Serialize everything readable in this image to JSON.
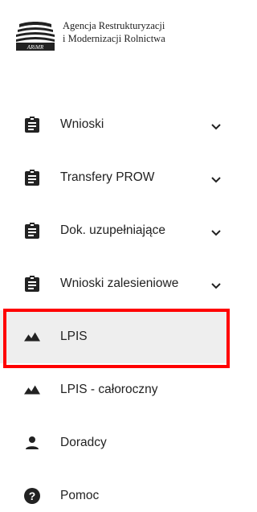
{
  "logo": {
    "mark_text": "ARiMR",
    "line1": "Agencja Restrukturyzacji",
    "line2": "i Modernizacji Rolnictwa"
  },
  "nav": {
    "items": [
      {
        "label": "Wnioski",
        "icon": "clipboard-icon",
        "expandable": true
      },
      {
        "label": "Transfery PROW",
        "icon": "clipboard-icon",
        "expandable": true
      },
      {
        "label": "Dok. uzupełniające",
        "icon": "clipboard-icon",
        "expandable": true
      },
      {
        "label": "Wnioski zalesieniowe",
        "icon": "clipboard-icon",
        "expandable": true
      },
      {
        "label": "LPIS",
        "icon": "landscape-icon",
        "expandable": false,
        "active": true
      },
      {
        "label": "LPIS - całoroczny",
        "icon": "landscape-icon",
        "expandable": false
      },
      {
        "label": "Doradcy",
        "icon": "person-icon",
        "expandable": false
      },
      {
        "label": "Pomoc",
        "icon": "help-icon",
        "expandable": false
      }
    ]
  },
  "colors": {
    "highlight": "#ff0000",
    "active_bg": "#eeeeee",
    "icon": "#222222"
  }
}
